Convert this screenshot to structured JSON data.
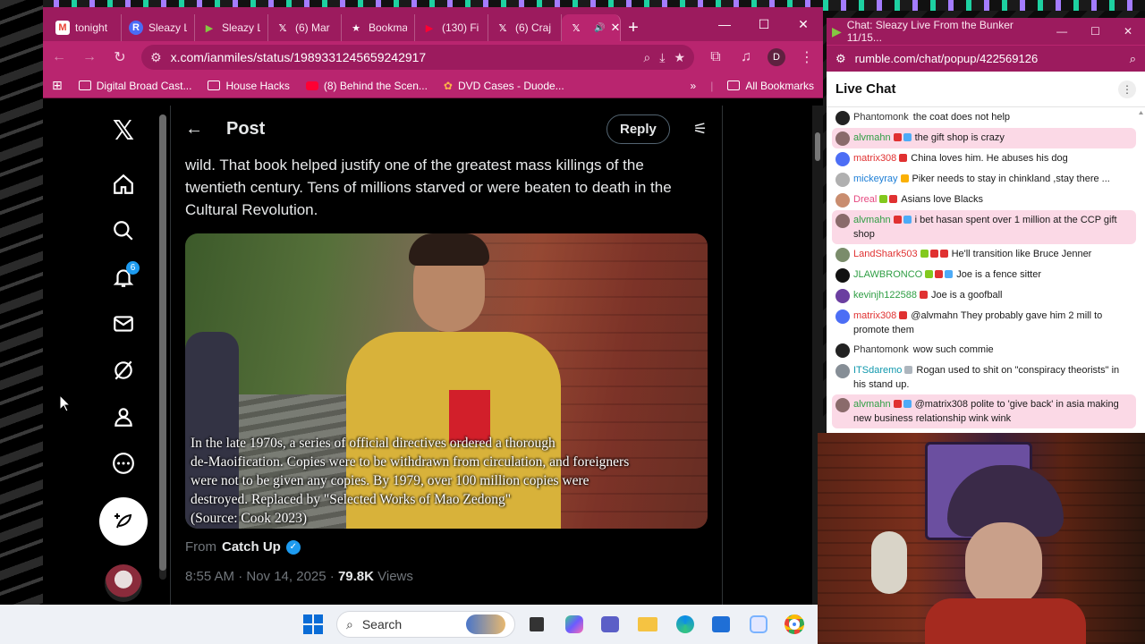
{
  "browser": {
    "tabs": [
      {
        "label": "tonight",
        "favicon": "gmail-icon",
        "color": "#ea4335",
        "glyph": "M"
      },
      {
        "label": "Sleazy L",
        "favicon": "rumble-r-icon",
        "color": "#4a6cf7",
        "glyph": "R"
      },
      {
        "label": "Sleazy L",
        "favicon": "rumble-play-icon",
        "color": "#85c742",
        "glyph": "▶"
      },
      {
        "label": "(6) Mar",
        "favicon": "x-icon",
        "color": "#000000",
        "glyph": "𝕏"
      },
      {
        "label": "Bookma",
        "favicon": "star-icon",
        "color": "#ffffff",
        "glyph": "★"
      },
      {
        "label": "(130) Fi",
        "favicon": "youtube-icon",
        "color": "#ff0033",
        "glyph": "▶"
      },
      {
        "label": "(6) Craj",
        "favicon": "x-icon",
        "color": "#000000",
        "glyph": "𝕏"
      },
      {
        "label": "(",
        "favicon": "x-icon",
        "color": "#000000",
        "glyph": "𝕏"
      }
    ],
    "url": "x.com/ianmiles/status/1989331245659242917",
    "profile_initial": "D",
    "bookmarks": [
      {
        "label": "Digital Broad Cast...",
        "icon": "folder-icon"
      },
      {
        "label": "House Hacks",
        "icon": "folder-icon"
      },
      {
        "label": "(8) Behind the Scen...",
        "icon": "youtube-icon"
      },
      {
        "label": "DVD Cases - Duode...",
        "icon": "duode-icon"
      }
    ],
    "all_bookmarks": "All Bookmarks"
  },
  "post": {
    "header_title": "Post",
    "reply_label": "Reply",
    "notification_count": "6",
    "text": "wild. That book helped justify one of the greatest mass killings of the twentieth century. Tens of millions starved or were beaten to death in the Cultural Revolution.",
    "caption_lines": [
      "In the late 1970s, a series of official directives ordered a thorough",
      "de-Maoification. Copies were to be withdrawn from circulation, and foreigners",
      "were not to be given any copies. By 1979, over 100 million copies were",
      "destroyed. Replaced by \"Selected Works of Mao Zedong\"",
      "(Source: Cook 2023)"
    ],
    "from_prefix": "From",
    "from_source": "Catch Up",
    "timestamp": "8:55 AM · Nov 14, 2025 · ",
    "views_count": "79.8K",
    "views_label": "Views"
  },
  "chat": {
    "window_title": "Chat: Sleazy Live From the Bunker 11/15...",
    "url": "rumble.com/chat/popup/422569126",
    "header": "Live Chat",
    "messages": [
      {
        "user": "Phantomonk",
        "text": "the coat does not help",
        "user_color": "#333333",
        "highlight": false,
        "avatar": "#222222",
        "badges": []
      },
      {
        "user": "alvmahn",
        "text": "the gift shop is crazy",
        "user_color": "#2f9e44",
        "highlight": true,
        "avatar": "#8a6b6b",
        "badges": [
          "#e03131",
          "#4dabf7"
        ]
      },
      {
        "user": "matrix308",
        "text": "China loves him. He abuses his dog",
        "user_color": "#e03131",
        "highlight": false,
        "avatar": "#4c6ef5",
        "badges": [
          "#e03131"
        ]
      },
      {
        "user": "mickeyray",
        "text": "Piker needs to stay in chinkland ,stay there ...",
        "user_color": "#1c7ed6",
        "highlight": false,
        "avatar": "#b0b0b0",
        "badges": [
          "#fab005"
        ]
      },
      {
        "user": "Dreal",
        "text": "Asians love Blacks",
        "user_color": "#e64980",
        "highlight": false,
        "avatar": "#c98d6f",
        "badges": [
          "#82c91e",
          "#e03131"
        ]
      },
      {
        "user": "alvmahn",
        "text": "i bet hasan spent over 1 million at the CCP gift shop",
        "user_color": "#2f9e44",
        "highlight": true,
        "avatar": "#8a6b6b",
        "badges": [
          "#e03131",
          "#4dabf7"
        ]
      },
      {
        "user": "LandShark503",
        "text": "He'll transition like Bruce Jenner",
        "user_color": "#e03131",
        "highlight": false,
        "avatar": "#7a8c6b",
        "badges": [
          "#82c91e",
          "#e03131",
          "#e03131"
        ]
      },
      {
        "user": "JLAWBRONCO",
        "text": "Joe is a fence sitter",
        "user_color": "#2f9e44",
        "highlight": false,
        "avatar": "#111111",
        "badges": [
          "#82c91e",
          "#e03131",
          "#4dabf7"
        ]
      },
      {
        "user": "kevinjh122588",
        "text": "Joe is a goofball",
        "user_color": "#2f9e44",
        "highlight": false,
        "avatar": "#6b3fa0",
        "badges": [
          "#e03131"
        ]
      },
      {
        "user": "matrix308",
        "text": "@alvmahn They probably gave him 2 mill to promote them",
        "user_color": "#e03131",
        "highlight": false,
        "avatar": "#4c6ef5",
        "badges": [
          "#e03131"
        ]
      },
      {
        "user": "Phantomonk",
        "text": "wow such commie",
        "user_color": "#333333",
        "highlight": false,
        "avatar": "#222222",
        "badges": []
      },
      {
        "user": "ITSdaremo",
        "text": "Rogan used to shit on \"conspiracy theorists\" in his stand up.",
        "user_color": "#1098ad",
        "highlight": false,
        "avatar": "#868e96",
        "badges": [
          "#adb5bd"
        ]
      },
      {
        "user": "alvmahn",
        "text": "@matrix308 polite to 'give back' in asia making new business relationship wink wink",
        "user_color": "#2f9e44",
        "highlight": true,
        "avatar": "#8a6b6b",
        "badges": [
          "#e03131",
          "#4dabf7"
        ]
      }
    ]
  },
  "taskbar": {
    "search_placeholder": "Search"
  }
}
